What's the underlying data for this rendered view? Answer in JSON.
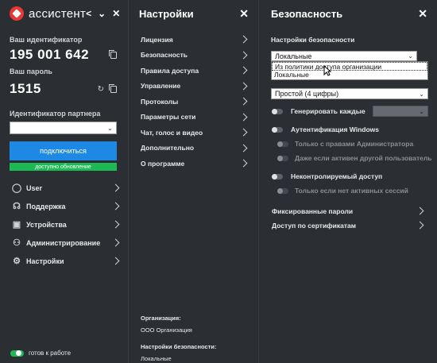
{
  "app": {
    "logo_text": "ассистент",
    "header_controls": [
      "<",
      "⌄",
      "✕"
    ]
  },
  "left": {
    "id_label": "Ваш идентификатор",
    "id_value": "195 001 642",
    "password_label": "Ваш пароль",
    "password_value": "1515",
    "partner_label": "Идентификатор партнера",
    "partner_value": "",
    "connect_label": "подключиться",
    "update_label": "доступно обновление",
    "nav": [
      {
        "label": "User",
        "icon": "user-icon"
      },
      {
        "label": "Поддержка",
        "icon": "headset-icon"
      },
      {
        "label": "Устройства",
        "icon": "devices-icon"
      },
      {
        "label": "Администрирование",
        "icon": "admin-icon"
      },
      {
        "label": "Настройки",
        "icon": "settings-icon"
      }
    ],
    "status_label": "готов к работе",
    "status_color": "#1db954"
  },
  "settings": {
    "title": "Настройки",
    "items": [
      "Лицензия",
      "Безопасность",
      "Правила доступа",
      "Управление",
      "Протоколы",
      "Параметры сети",
      "Чат, голос и видео",
      "Дополнительно",
      "О программе"
    ],
    "org_label": "Организация:",
    "org_value": "ООО Организация",
    "sec_label": "Настройки безопасности:",
    "sec_value": "Локальные"
  },
  "security": {
    "title": "Безопасность",
    "settings_label": "Настройки безопасности",
    "settings_value": "Локальные",
    "dropdown_options": [
      "Из политики доступа организации",
      "Локальные"
    ],
    "password_type": "Простой (4 цифры)",
    "generate_label": "Генерировать каждые",
    "windows_auth_label": "Аутентификация Windows",
    "admin_only_label": "Только с правами Администратора",
    "other_user_label": "Даже если активен другой пользователь",
    "uncontrolled_label": "Неконтролируемый доступ",
    "no_sessions_label": "Только если нет активных сессий",
    "fixed_passwords_label": "Фиксированные пароли",
    "cert_access_label": "Доступ по сертификатам"
  },
  "colors": {
    "accent": "#1e88e5",
    "green": "#1db954",
    "bg": "#2b2e33"
  }
}
